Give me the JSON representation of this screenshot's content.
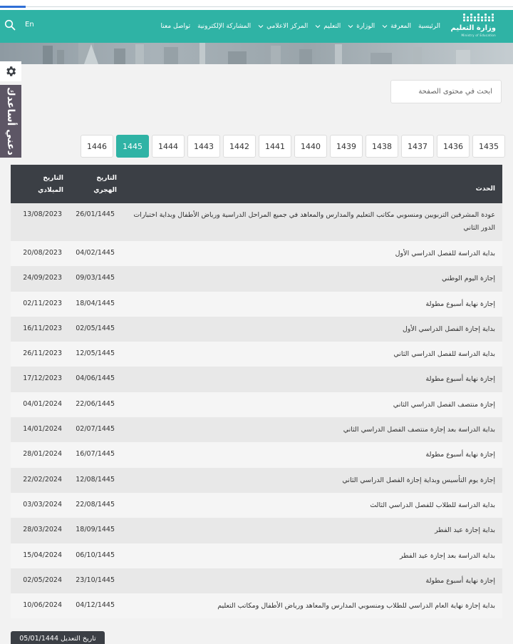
{
  "header": {
    "logo_name": "وزارة التعليم",
    "logo_sub": "Ministry of Education",
    "nav": [
      {
        "label": "الرئيسية",
        "dropdown": false
      },
      {
        "label": "المعرفة",
        "dropdown": true
      },
      {
        "label": "الوزارة",
        "dropdown": true
      },
      {
        "label": "التعليم",
        "dropdown": true
      },
      {
        "label": "المركز الاعلامي",
        "dropdown": true
      },
      {
        "label": "المشاركة الإلكترونية",
        "dropdown": false
      },
      {
        "label": "تواصل معنا",
        "dropdown": false
      }
    ],
    "lang": "En",
    "accent_color": "#2fb3a5"
  },
  "help": {
    "label": "دعني أساعدك"
  },
  "search": {
    "placeholder": "ابحث في محتوى الصفحة"
  },
  "years": {
    "items": [
      "1435",
      "1436",
      "1437",
      "1438",
      "1439",
      "1440",
      "1441",
      "1442",
      "1443",
      "1444",
      "1445",
      "1446"
    ],
    "active": "1445"
  },
  "table": {
    "headers": {
      "event": "الحدث",
      "hijri": "التاريخ الهجري",
      "gregorian": "التاريخ الميلادي"
    },
    "rows": [
      {
        "event": "عودة المشرفين التربويين ومنسوبي مكاتب التعليم والمدارس والمعاهد في جميع المراحل الدراسية ورياض الأطفال وبداية اختبارات الدور الثاني",
        "hijri": "26/01/1445",
        "gregorian": "13/08/2023"
      },
      {
        "event": "بداية الدراسة للفصل الدراسي الأول",
        "hijri": "04/02/1445",
        "gregorian": "20/08/2023"
      },
      {
        "event": "إجازة اليوم الوطني",
        "hijri": "09/03/1445",
        "gregorian": "24/09/2023"
      },
      {
        "event": "إجازة نهاية أسبوع مطولة",
        "hijri": "18/04/1445",
        "gregorian": "02/11/2023"
      },
      {
        "event": "بداية إجازة الفصل الدراسي الأول",
        "hijri": "02/05/1445",
        "gregorian": "16/11/2023"
      },
      {
        "event": "بداية الدراسة للفصل الدراسي الثاني",
        "hijri": "12/05/1445",
        "gregorian": "26/11/2023"
      },
      {
        "event": "إجازة نهاية أسبوع مطولة",
        "hijri": "04/06/1445",
        "gregorian": "17/12/2023"
      },
      {
        "event": "إجازة منتصف الفصل الدراسي الثاني",
        "hijri": "22/06/1445",
        "gregorian": "04/01/2024"
      },
      {
        "event": "بداية الدراسة بعد إجازة منتصف الفصل الدراسي الثاني",
        "hijri": "02/07/1445",
        "gregorian": "14/01/2024"
      },
      {
        "event": "إجازة نهاية أسبوع مطولة",
        "hijri": "16/07/1445",
        "gregorian": "28/01/2024"
      },
      {
        "event": "إجازة يوم التأسيس وبداية إجازة الفصل الدراسي الثاني",
        "hijri": "12/08/1445",
        "gregorian": "22/02/2024"
      },
      {
        "event": "بداية الدراسة للطلاب للفصل الدراسي الثالث",
        "hijri": "22/08/1445",
        "gregorian": "03/03/2024"
      },
      {
        "event": "بداية إجازة عيد الفطر",
        "hijri": "18/09/1445",
        "gregorian": "28/03/2024"
      },
      {
        "event": "بداية الدراسة بعد إجازة عيد الفطر",
        "hijri": "06/10/1445",
        "gregorian": "15/04/2024"
      },
      {
        "event": "إجازة نهاية أسبوع مطولة",
        "hijri": "23/10/1445",
        "gregorian": "02/05/2024"
      },
      {
        "event": "بداية إجازة نهاية العام الدراسي للطلاب ومنسوبي المدارس والمعاهد ورياض الأطفال ومكاتب التعليم",
        "hijri": "04/12/1445",
        "gregorian": "10/06/2024"
      }
    ]
  },
  "footer": {
    "modified": "تاريخ التعديل 05/01/1444"
  }
}
